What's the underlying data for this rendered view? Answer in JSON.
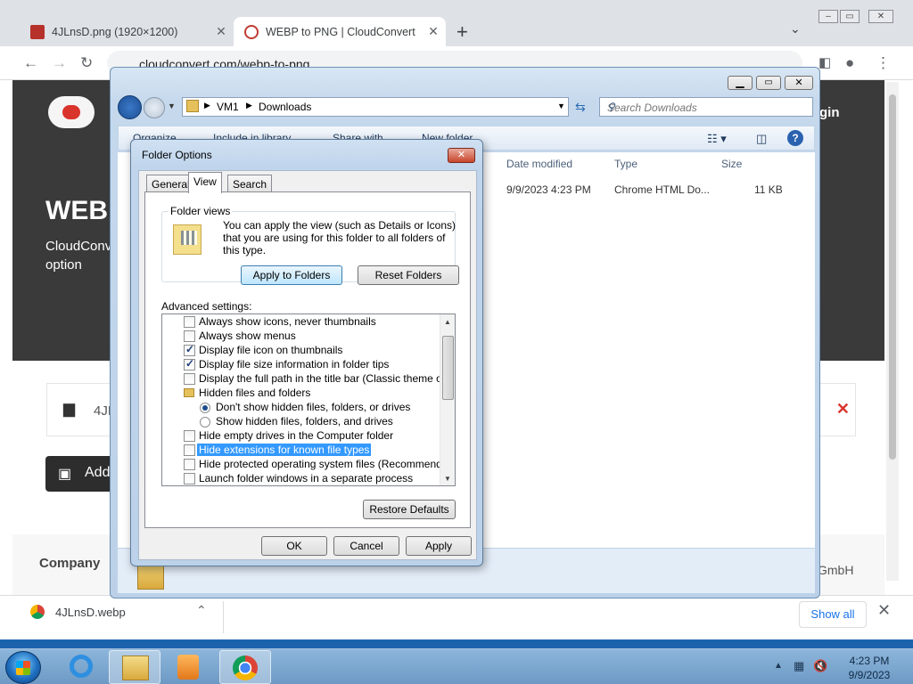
{
  "chrome": {
    "tabs": [
      {
        "label": "4JLnsD.png (1920×1200)"
      },
      {
        "label": "WEBP to PNG | CloudConvert"
      }
    ],
    "url": "cloudconvert.com/webp-to-png"
  },
  "webpage": {
    "hero_title": "WEBP",
    "hero_desc": "CloudConvert others, we the option",
    "login": "gin",
    "file_name": "4JL",
    "add_button": "Add",
    "company": "Company",
    "gmbh": "GmbH"
  },
  "download_bar": {
    "file": "4JLnsD.webp",
    "show_all": "Show all"
  },
  "explorer": {
    "breadcrumb": [
      "VM1",
      "Downloads"
    ],
    "search_placeholder": "Search Downloads",
    "commands": [
      "Organize",
      "Include in library",
      "Share with",
      "New folder"
    ],
    "columns": [
      "Date modified",
      "Type",
      "Size"
    ],
    "file_row": {
      "date": "9/9/2023 4:23 PM",
      "type": "Chrome HTML Do...",
      "size": "11 KB"
    }
  },
  "folder_options": {
    "title": "Folder Options",
    "tabs": [
      "General",
      "View",
      "Search"
    ],
    "active_tab": "View",
    "folder_views_title": "Folder views",
    "folder_views_text": "You can apply the view (such as Details or Icons) that you are using for this folder to all folders of this type.",
    "apply_to_folders": "Apply to Folders",
    "reset_folders": "Reset Folders",
    "advanced_label": "Advanced settings:",
    "settings": [
      {
        "type": "checkbox",
        "checked": false,
        "label": "Always show icons, never thumbnails"
      },
      {
        "type": "checkbox",
        "checked": false,
        "label": "Always show menus"
      },
      {
        "type": "checkbox",
        "checked": true,
        "label": "Display file icon on thumbnails"
      },
      {
        "type": "checkbox",
        "checked": true,
        "label": "Display file size information in folder tips"
      },
      {
        "type": "checkbox",
        "checked": false,
        "label": "Display the full path in the title bar (Classic theme only)"
      },
      {
        "type": "folder",
        "label": "Hidden files and folders"
      },
      {
        "type": "radio",
        "checked": true,
        "label": "Don't show hidden files, folders, or drives"
      },
      {
        "type": "radio",
        "checked": false,
        "label": "Show hidden files, folders, and drives"
      },
      {
        "type": "checkbox",
        "checked": false,
        "label": "Hide empty drives in the Computer folder"
      },
      {
        "type": "checkbox",
        "checked": false,
        "selected": true,
        "label": "Hide extensions for known file types"
      },
      {
        "type": "checkbox",
        "checked": false,
        "label": "Hide protected operating system files (Recommended)"
      },
      {
        "type": "checkbox",
        "checked": false,
        "label": "Launch folder windows in a separate process"
      }
    ],
    "restore_defaults": "Restore Defaults",
    "ok": "OK",
    "cancel": "Cancel",
    "apply": "Apply"
  },
  "taskbar": {
    "apps": [
      "internet-explorer-icon",
      "file-explorer-icon",
      "media-player-icon",
      "chrome-icon"
    ],
    "time": "4:23 PM",
    "date": "9/9/2023"
  }
}
